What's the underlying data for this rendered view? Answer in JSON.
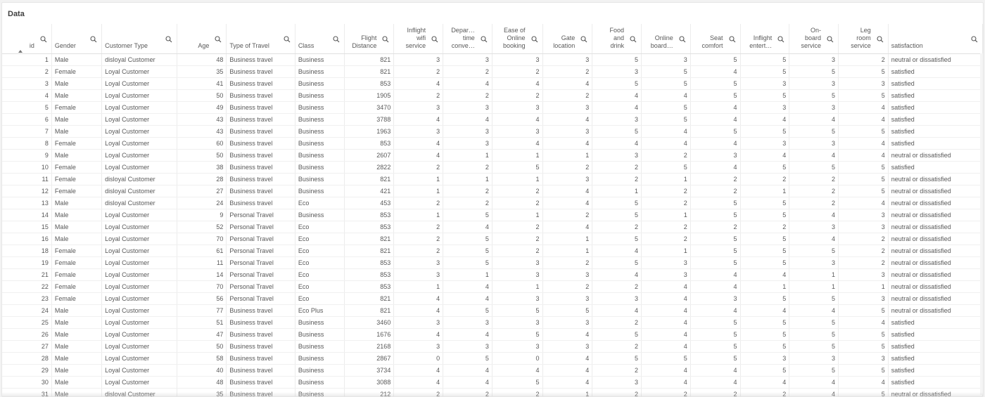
{
  "panel": {
    "title": "Data"
  },
  "columns": [
    {
      "key": "id",
      "label": "id",
      "align": "right",
      "sorted": "asc"
    },
    {
      "key": "gender",
      "label": "Gender",
      "align": "left"
    },
    {
      "key": "customer_type",
      "label": "Customer Type",
      "align": "left"
    },
    {
      "key": "age",
      "label": "Age",
      "align": "right"
    },
    {
      "key": "type_of_travel",
      "label": "Type of Travel",
      "align": "left"
    },
    {
      "key": "class",
      "label": "Class",
      "align": "left"
    },
    {
      "key": "flight_distance",
      "label": "Flight\nDistance",
      "align": "right"
    },
    {
      "key": "inflight_wifi",
      "label": "Inflight\nwifi\nservice",
      "align": "right"
    },
    {
      "key": "departure_convenience",
      "label": "Depar…\ntime\nconve…",
      "align": "right"
    },
    {
      "key": "ease_online_booking",
      "label": "Ease of\nOnline\nbooking",
      "align": "right"
    },
    {
      "key": "gate_location",
      "label": "Gate\nlocation",
      "align": "right"
    },
    {
      "key": "food_drink",
      "label": "Food\nand\ndrink",
      "align": "right"
    },
    {
      "key": "online_boarding",
      "label": "Online\nboard…",
      "align": "right"
    },
    {
      "key": "seat_comfort",
      "label": "Seat\ncomfort",
      "align": "right"
    },
    {
      "key": "inflight_entertainment",
      "label": "Inflight\nentert…",
      "align": "right"
    },
    {
      "key": "onboard_service",
      "label": "On-\nboard\nservice",
      "align": "right"
    },
    {
      "key": "leg_room",
      "label": "Leg\nroom\nservice",
      "align": "right"
    },
    {
      "key": "satisfaction",
      "label": "satisfaction",
      "align": "left"
    }
  ],
  "rows": [
    [
      "1",
      "Male",
      "disloyal Customer",
      "48",
      "Business travel",
      "Business",
      "821",
      "3",
      "3",
      "3",
      "3",
      "5",
      "3",
      "5",
      "5",
      "3",
      "2",
      "neutral or dissatisfied"
    ],
    [
      "2",
      "Female",
      "Loyal Customer",
      "35",
      "Business travel",
      "Business",
      "821",
      "2",
      "2",
      "2",
      "2",
      "3",
      "5",
      "4",
      "5",
      "5",
      "5",
      "satisfied"
    ],
    [
      "3",
      "Male",
      "Loyal Customer",
      "41",
      "Business travel",
      "Business",
      "853",
      "4",
      "4",
      "4",
      "4",
      "5",
      "5",
      "5",
      "3",
      "3",
      "3",
      "satisfied"
    ],
    [
      "4",
      "Male",
      "Loyal Customer",
      "50",
      "Business travel",
      "Business",
      "1905",
      "2",
      "2",
      "2",
      "2",
      "4",
      "4",
      "5",
      "5",
      "5",
      "5",
      "satisfied"
    ],
    [
      "5",
      "Female",
      "Loyal Customer",
      "49",
      "Business travel",
      "Business",
      "3470",
      "3",
      "3",
      "3",
      "3",
      "4",
      "5",
      "4",
      "3",
      "3",
      "4",
      "satisfied"
    ],
    [
      "6",
      "Male",
      "Loyal Customer",
      "43",
      "Business travel",
      "Business",
      "3788",
      "4",
      "4",
      "4",
      "4",
      "3",
      "5",
      "4",
      "4",
      "4",
      "4",
      "satisfied"
    ],
    [
      "7",
      "Male",
      "Loyal Customer",
      "43",
      "Business travel",
      "Business",
      "1963",
      "3",
      "3",
      "3",
      "3",
      "5",
      "4",
      "5",
      "5",
      "5",
      "5",
      "satisfied"
    ],
    [
      "8",
      "Female",
      "Loyal Customer",
      "60",
      "Business travel",
      "Business",
      "853",
      "4",
      "3",
      "4",
      "4",
      "4",
      "4",
      "4",
      "3",
      "3",
      "4",
      "satisfied"
    ],
    [
      "9",
      "Male",
      "Loyal Customer",
      "50",
      "Business travel",
      "Business",
      "2607",
      "4",
      "1",
      "1",
      "1",
      "3",
      "2",
      "3",
      "4",
      "4",
      "4",
      "neutral or dissatisfied"
    ],
    [
      "10",
      "Female",
      "Loyal Customer",
      "38",
      "Business travel",
      "Business",
      "2822",
      "2",
      "2",
      "5",
      "2",
      "2",
      "5",
      "4",
      "5",
      "5",
      "5",
      "satisfied"
    ],
    [
      "11",
      "Female",
      "disloyal Customer",
      "28",
      "Business travel",
      "Business",
      "821",
      "1",
      "1",
      "1",
      "3",
      "2",
      "1",
      "2",
      "2",
      "2",
      "5",
      "neutral or dissatisfied"
    ],
    [
      "12",
      "Female",
      "disloyal Customer",
      "27",
      "Business travel",
      "Business",
      "421",
      "1",
      "2",
      "2",
      "4",
      "1",
      "2",
      "2",
      "1",
      "2",
      "5",
      "neutral or dissatisfied"
    ],
    [
      "13",
      "Male",
      "disloyal Customer",
      "24",
      "Business travel",
      "Eco",
      "453",
      "2",
      "2",
      "2",
      "4",
      "5",
      "2",
      "5",
      "5",
      "2",
      "4",
      "neutral or dissatisfied"
    ],
    [
      "14",
      "Male",
      "Loyal Customer",
      "9",
      "Personal Travel",
      "Business",
      "853",
      "1",
      "5",
      "1",
      "2",
      "5",
      "1",
      "5",
      "5",
      "4",
      "3",
      "neutral or dissatisfied"
    ],
    [
      "15",
      "Male",
      "Loyal Customer",
      "52",
      "Personal Travel",
      "Eco",
      "853",
      "2",
      "4",
      "2",
      "4",
      "2",
      "2",
      "2",
      "2",
      "3",
      "3",
      "neutral or dissatisfied"
    ],
    [
      "16",
      "Male",
      "Loyal Customer",
      "70",
      "Personal Travel",
      "Eco",
      "821",
      "2",
      "5",
      "2",
      "1",
      "5",
      "2",
      "5",
      "5",
      "4",
      "2",
      "neutral or dissatisfied"
    ],
    [
      "18",
      "Female",
      "Loyal Customer",
      "61",
      "Personal Travel",
      "Eco",
      "821",
      "2",
      "5",
      "2",
      "1",
      "4",
      "1",
      "5",
      "5",
      "5",
      "2",
      "neutral or dissatisfied"
    ],
    [
      "19",
      "Female",
      "Loyal Customer",
      "11",
      "Personal Travel",
      "Eco",
      "853",
      "3",
      "5",
      "3",
      "2",
      "5",
      "3",
      "5",
      "5",
      "3",
      "2",
      "neutral or dissatisfied"
    ],
    [
      "21",
      "Female",
      "Loyal Customer",
      "14",
      "Personal Travel",
      "Eco",
      "853",
      "3",
      "1",
      "3",
      "3",
      "4",
      "3",
      "4",
      "4",
      "1",
      "3",
      "neutral or dissatisfied"
    ],
    [
      "22",
      "Female",
      "Loyal Customer",
      "70",
      "Personal Travel",
      "Eco",
      "853",
      "1",
      "4",
      "1",
      "2",
      "2",
      "4",
      "4",
      "1",
      "1",
      "1",
      "neutral or dissatisfied"
    ],
    [
      "23",
      "Female",
      "Loyal Customer",
      "56",
      "Personal Travel",
      "Eco",
      "821",
      "4",
      "4",
      "3",
      "3",
      "3",
      "4",
      "3",
      "5",
      "5",
      "3",
      "neutral or dissatisfied"
    ],
    [
      "24",
      "Male",
      "Loyal Customer",
      "77",
      "Business travel",
      "Eco Plus",
      "821",
      "4",
      "5",
      "5",
      "5",
      "4",
      "4",
      "4",
      "4",
      "4",
      "5",
      "neutral or dissatisfied"
    ],
    [
      "25",
      "Male",
      "Loyal Customer",
      "51",
      "Business travel",
      "Business",
      "3460",
      "3",
      "3",
      "3",
      "3",
      "2",
      "4",
      "5",
      "5",
      "5",
      "4",
      "satisfied"
    ],
    [
      "26",
      "Male",
      "Loyal Customer",
      "47",
      "Business travel",
      "Business",
      "1676",
      "4",
      "4",
      "5",
      "4",
      "5",
      "4",
      "5",
      "5",
      "5",
      "5",
      "satisfied"
    ],
    [
      "27",
      "Male",
      "Loyal Customer",
      "50",
      "Business travel",
      "Business",
      "2168",
      "3",
      "3",
      "3",
      "3",
      "2",
      "4",
      "5",
      "5",
      "5",
      "5",
      "satisfied"
    ],
    [
      "28",
      "Male",
      "Loyal Customer",
      "58",
      "Business travel",
      "Business",
      "2867",
      "0",
      "5",
      "0",
      "4",
      "5",
      "5",
      "5",
      "3",
      "3",
      "3",
      "satisfied"
    ],
    [
      "29",
      "Male",
      "Loyal Customer",
      "40",
      "Business travel",
      "Business",
      "3734",
      "4",
      "4",
      "4",
      "4",
      "2",
      "4",
      "4",
      "5",
      "5",
      "5",
      "satisfied"
    ],
    [
      "30",
      "Male",
      "Loyal Customer",
      "48",
      "Business travel",
      "Business",
      "3088",
      "4",
      "4",
      "5",
      "4",
      "3",
      "4",
      "4",
      "4",
      "4",
      "4",
      "satisfied"
    ],
    [
      "31",
      "Male",
      "disloyal Customer",
      "35",
      "Business travel",
      "Business",
      "212",
      "2",
      "2",
      "2",
      "1",
      "2",
      "2",
      "2",
      "2",
      "4",
      "5",
      "neutral or dissatisfied"
    ]
  ]
}
